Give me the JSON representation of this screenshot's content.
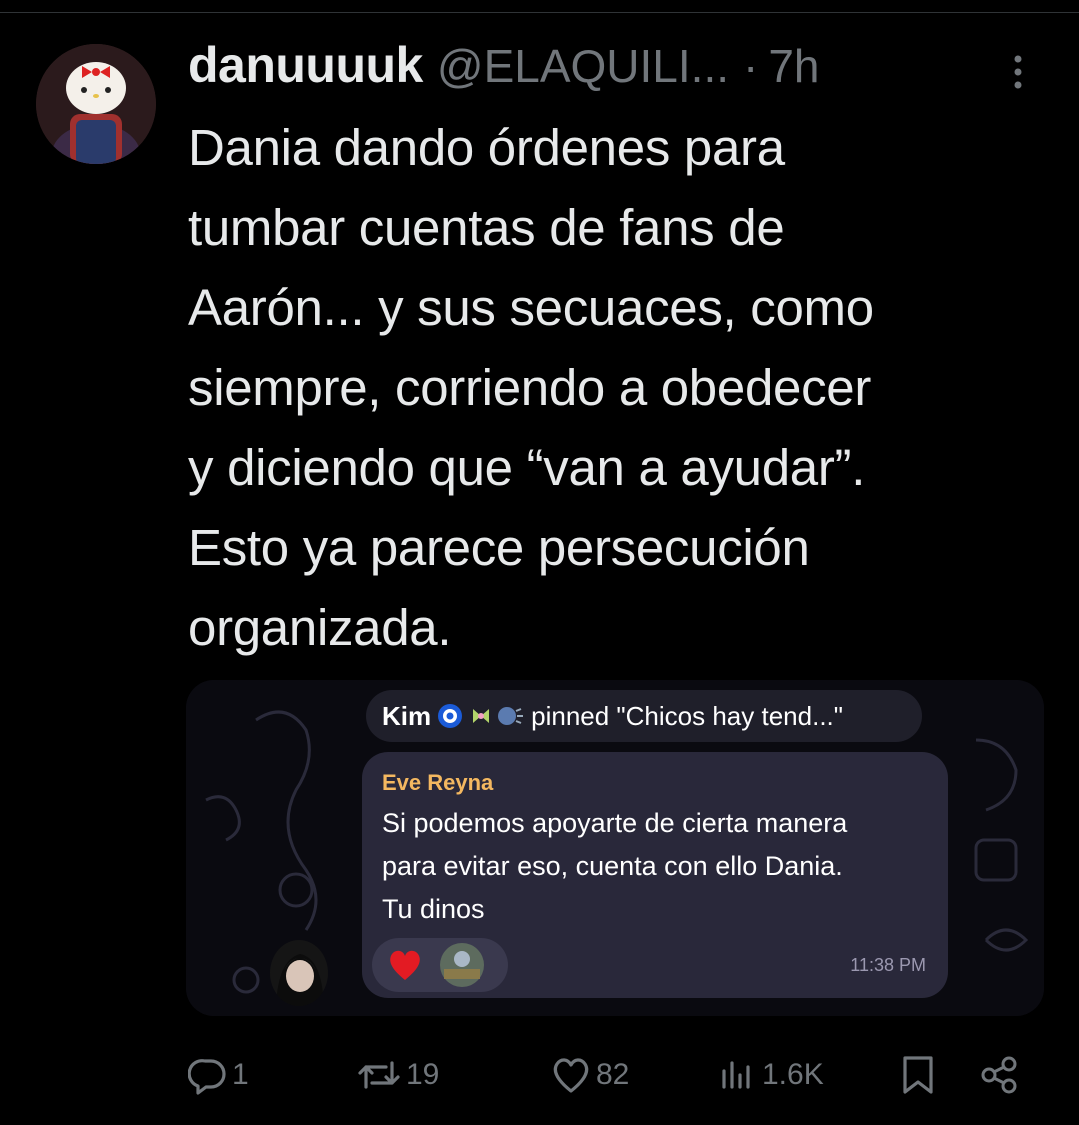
{
  "tweet": {
    "display_name": "danuuuuk",
    "handle": "@ELAQUILI...",
    "separator": "·",
    "time": "7h",
    "text": "Dania dando órdenes para\ntumbar cuentas de fans de\nAarón... y sus secuaces, como\nsiempre, corriendo a obedecer\ny diciendo que “van a ayudar”.\nEsto ya parece persecución\norganizada."
  },
  "media": {
    "pinned_name": "Kim",
    "pinned_text": "pinned \"Chicos hay tend...\"",
    "sender": "Eve Reyna",
    "message": "Si podemos apoyarte de cierta manera\npara evitar eso, cuenta con ello Dania.\nTu dinos",
    "message_time": "11:38 PM"
  },
  "actions": {
    "replies": "1",
    "reposts": "19",
    "likes": "82",
    "views": "1.6K"
  },
  "colors": {
    "background": "#000000",
    "text": "#e7e9ea",
    "secondary": "#71767b",
    "sender": "#f4b860",
    "bubble": "#29283a"
  },
  "icons": [
    "more-icon",
    "reply-icon",
    "repost-icon",
    "like-icon",
    "views-icon",
    "bookmark-icon",
    "share-icon",
    "heart-reaction-icon"
  ]
}
